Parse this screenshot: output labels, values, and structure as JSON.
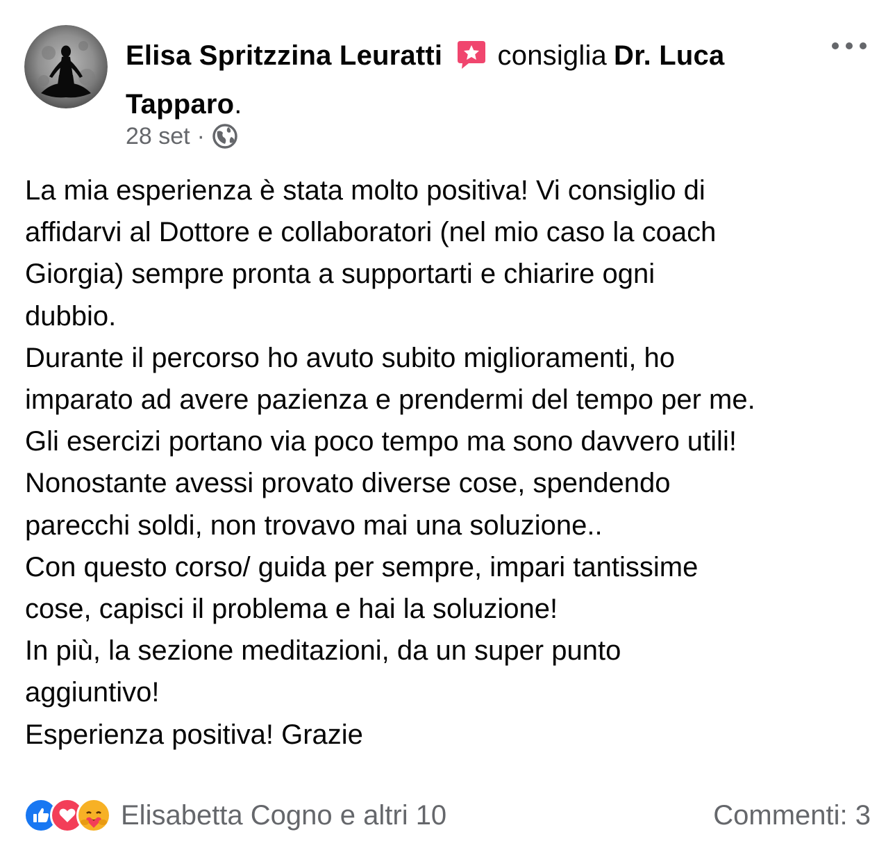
{
  "post": {
    "author": "Elisa Spritzzina Leuratti",
    "verb": "consiglia",
    "page": "Dr. Luca Tapparo",
    "page_punct": ".",
    "date": "28 set",
    "separator": "·",
    "audience_icon": "globe-icon",
    "badge_icon": "top-fan-star-badge-icon",
    "more_icon": "more-options-icon",
    "body_lines": [
      "La mia esperienza è stata molto positiva! Vi consiglio di",
      "affidarvi al Dottore e collaboratori (nel mio caso la coach",
      "Giorgia) sempre pronta a supportarti e chiarire ogni",
      "dubbio.",
      "Durante il percorso ho avuto subito miglioramenti, ho",
      "imparato ad avere pazienza e prendermi del tempo per me.",
      "Gli esercizi portano via poco tempo ma sono davvero utili!",
      "Nonostante avessi provato diverse cose, spendendo",
      "parecchi soldi, non trovavo mai una soluzione..",
      "Con questo corso/ guida per sempre, impari tantissime",
      "cose, capisci il problema e hai la soluzione!",
      "In più, la sezione meditazioni, da un super punto",
      "aggiuntivo!",
      "Esperienza positiva! Grazie"
    ]
  },
  "footer": {
    "reactions": [
      "like-reaction-icon",
      "love-reaction-icon",
      "care-reaction-icon"
    ],
    "reaction_summary": "Elisabetta Cogno e altri 10",
    "comments": "Commenti: 3"
  },
  "colors": {
    "text": "#050505",
    "secondary": "#65676b",
    "badge": "#f0466e",
    "like": "#1877f2",
    "love": "#f33e58",
    "care": "#f7b125"
  }
}
